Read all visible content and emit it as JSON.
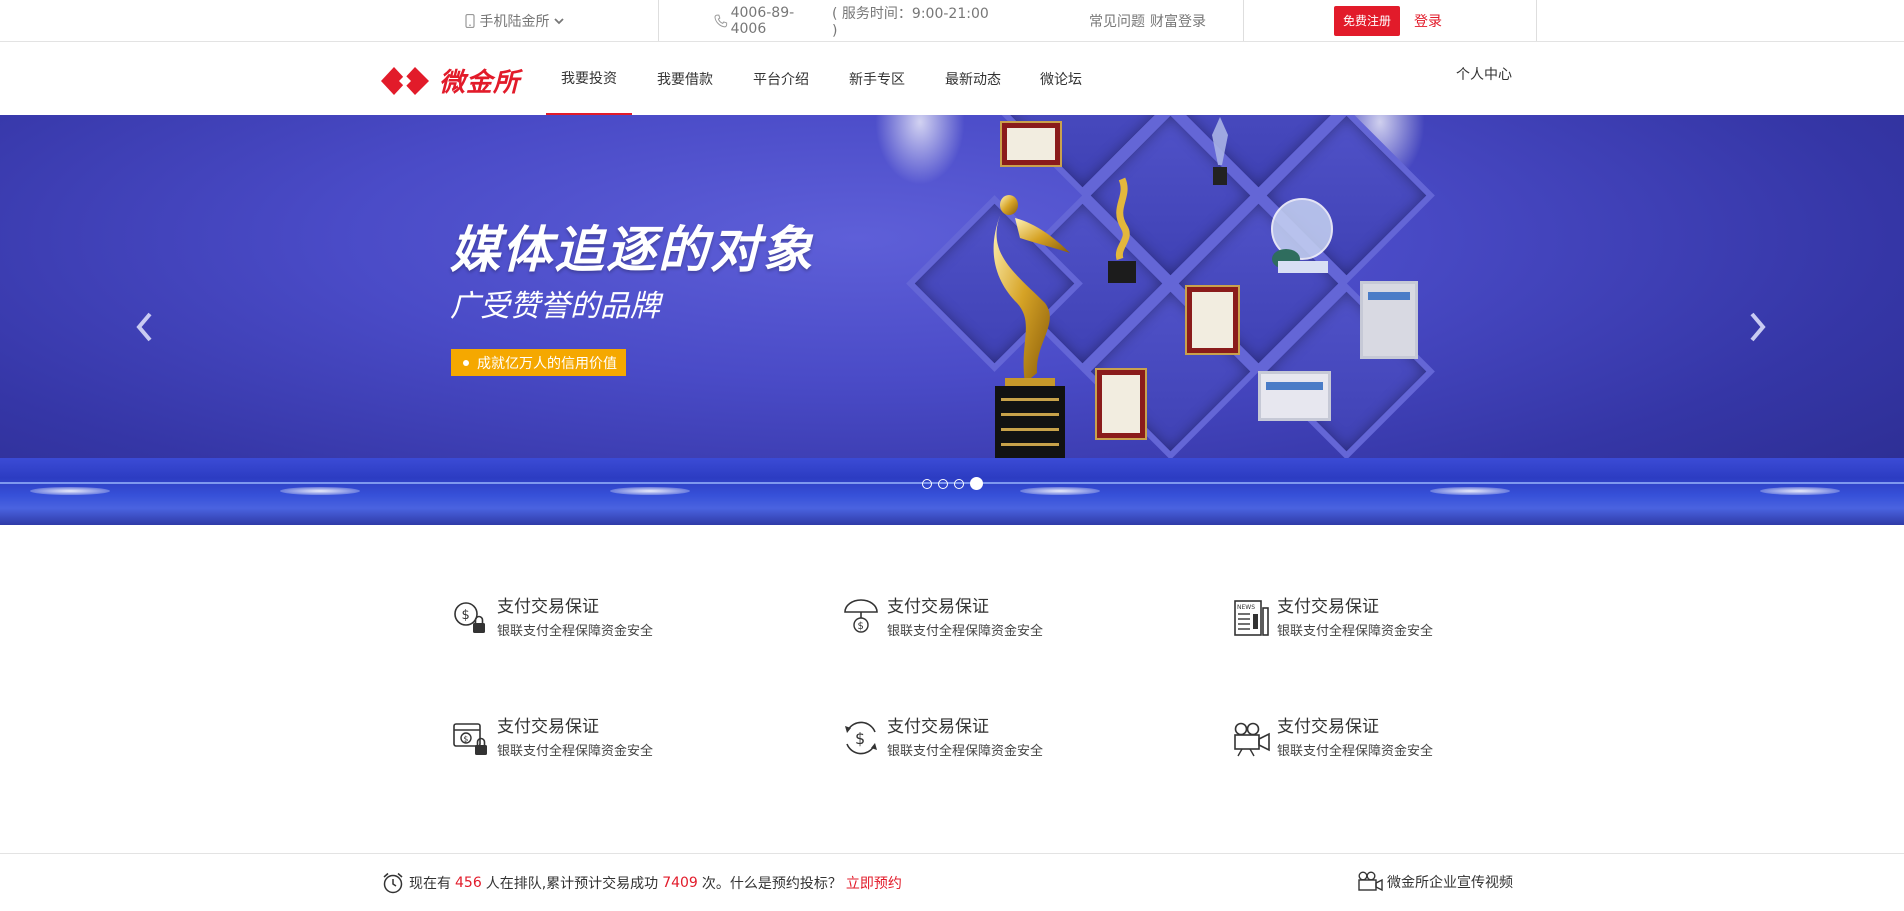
{
  "topbar": {
    "mobile_label": "手机陆金所",
    "phone": "4006-89-4006",
    "service_hours": "( 服务时间：9:00-21:00 )",
    "faq": "常见问题",
    "wealth_login": "财富登录",
    "register": "免费注册",
    "login": "登录"
  },
  "nav": {
    "logo_text": "微金所",
    "items": [
      "我要投资",
      "我要借款",
      "平台介绍",
      "新手专区",
      "最新动态",
      "微论坛"
    ],
    "active_index": 0,
    "personal_center": "个人中心"
  },
  "banner": {
    "title": "媒体追逐的对象",
    "subtitle": "广受赞誉的品牌",
    "tag": "成就亿万人的信用价值",
    "slides_total": 4,
    "active_slide": 4
  },
  "features": [
    {
      "icon": "dollar-lock-icon",
      "title": "支付交易保证",
      "desc": "银联支付全程保障资金安全"
    },
    {
      "icon": "umbrella-dollar-icon",
      "title": "支付交易保证",
      "desc": "银联支付全程保障资金安全"
    },
    {
      "icon": "newspaper-icon",
      "title": "支付交易保证",
      "desc": "银联支付全程保障资金安全"
    },
    {
      "icon": "wallet-lock-icon",
      "title": "支付交易保证",
      "desc": "银联支付全程保障资金安全"
    },
    {
      "icon": "dollar-cycle-icon",
      "title": "支付交易保证",
      "desc": "银联支付全程保障资金安全"
    },
    {
      "icon": "video-camera-icon",
      "title": "支付交易保证",
      "desc": "银联支付全程保障资金安全"
    }
  ],
  "bottombar": {
    "prefix": "现在有",
    "queue_count": "456",
    "mid": "人在排队,累计预计交易成功",
    "success_count": "7409",
    "suffix": "次。什么是预约投标？",
    "reserve_link": "立即预约",
    "video_label": "微金所企业宣传视频"
  },
  "colors": {
    "brand_red": "#e21b2a",
    "tag_orange": "#f5a800",
    "banner_blue": "#4a4bc7"
  }
}
